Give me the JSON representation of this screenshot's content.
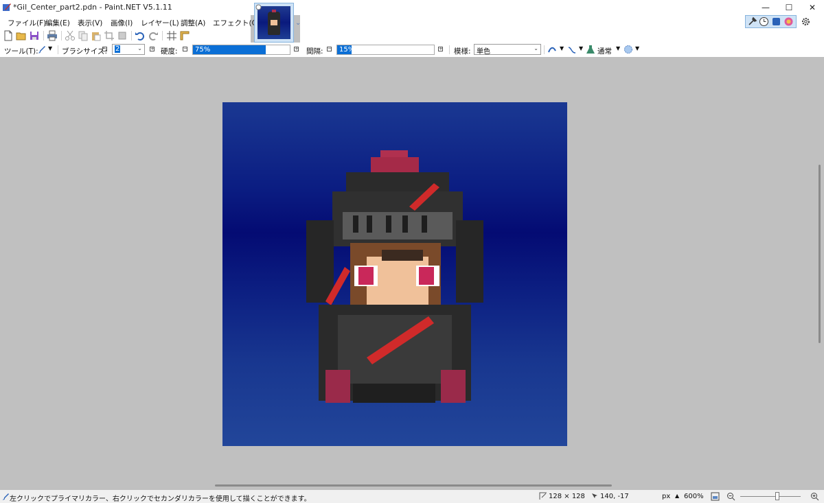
{
  "window": {
    "title": "*Gil_Center_part2.pdn - Paint.NET V5.1.11",
    "minimize_glyph": "—",
    "maximize_glyph": "☐",
    "close_glyph": "✕"
  },
  "menu": [
    {
      "label": "ファイル(F)"
    },
    {
      "label": "編集(E)"
    },
    {
      "label": "表示(V)"
    },
    {
      "label": "画像(I)"
    },
    {
      "label": "レイヤー(L)"
    },
    {
      "label": "調整(A)"
    },
    {
      "label": "エフェクト(C)"
    }
  ],
  "toolbar": {
    "icons": [
      "new-file-icon",
      "open-file-icon",
      "save-icon",
      "print-icon",
      "cut-icon",
      "copy-icon",
      "paste-icon",
      "crop-icon",
      "resize-icon",
      "undo-icon",
      "redo-icon",
      "grid-icon",
      "ruler-icon"
    ]
  },
  "right_icons": [
    "tools-icon",
    "history-icon",
    "layers-icon",
    "colors-icon",
    "settings-icon"
  ],
  "tool_options": {
    "tool_label": "ツール(T):",
    "brush_size_label": "ブラシサイズ:",
    "brush_size_value": "2",
    "hardness_label": "硬度:",
    "hardness_value": "75%",
    "hardness_fraction": 0.75,
    "spacing_label": "間隔:",
    "spacing_value": "15%",
    "spacing_fraction": 0.15,
    "pattern_label": "模様:",
    "pattern_value": "単色",
    "blend_mode_value": "通常"
  },
  "status": {
    "hint": "左クリックでプライマリカラー、右クリックでセカンダリカラーを使用して描くことができます。",
    "image_size": "128 × 128",
    "cursor_position": "140, -17",
    "units": "px",
    "zoom": "600%"
  },
  "colors": {
    "accent": "#0b6fd6",
    "canvas_top": "#1a3892",
    "canvas_mid": "#040b73",
    "canvas_bottom": "#22469a"
  }
}
